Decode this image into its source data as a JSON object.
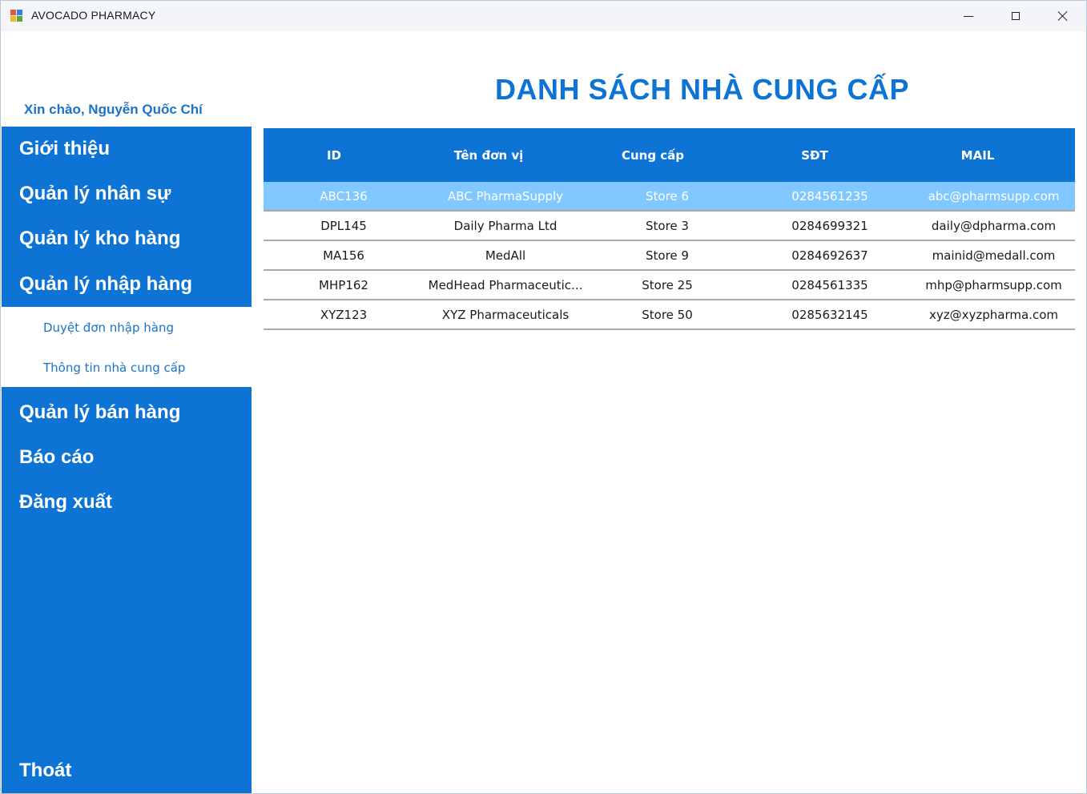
{
  "window": {
    "title": "AVOCADO PHARMACY"
  },
  "greeting": "Xin chào, Nguyễn Quốc Chí",
  "sidebar": {
    "items": [
      {
        "label": "Giới thiệu"
      },
      {
        "label": "Quản lý nhân sự"
      },
      {
        "label": "Quản lý kho hàng"
      },
      {
        "label": "Quản lý nhập hàng"
      },
      {
        "label": "Quản lý bán hàng"
      },
      {
        "label": "Báo cáo"
      },
      {
        "label": "Đăng xuất"
      }
    ],
    "submenu": [
      {
        "label": "Duyệt đơn nhập hàng"
      },
      {
        "label": "Thông tin nhà cung cấp"
      }
    ],
    "exit_label": "Thoát"
  },
  "main": {
    "title": "DANH SÁCH NHÀ CUNG CẤP",
    "table": {
      "columns": [
        "ID",
        "Tên đơn vị",
        "Cung cấp",
        "SĐT",
        "MAIL"
      ],
      "rows": [
        [
          "ABC136",
          "ABC PharmaSupply",
          "Store 6",
          "0284561235",
          "abc@pharmsupp.com"
        ],
        [
          "DPL145",
          "Daily Pharma Ltd",
          "Store 3",
          "0284699321",
          "daily@dpharma.com"
        ],
        [
          "MA156",
          "MedAll",
          "Store 9",
          "0284692637",
          "mainid@medall.com"
        ],
        [
          "MHP162",
          "MedHead Pharmaceutic...",
          "Store 25",
          "0284561335",
          "mhp@pharmsupp.com"
        ],
        [
          "XYZ123",
          "XYZ Pharmaceuticals",
          "Store 50",
          "0285632145",
          "xyz@xyzpharma.com"
        ]
      ],
      "selected_row": 0
    }
  },
  "colors": {
    "accent": "#0d74d6",
    "selected_row": "#80c8ff",
    "link": "#1a73c9"
  }
}
